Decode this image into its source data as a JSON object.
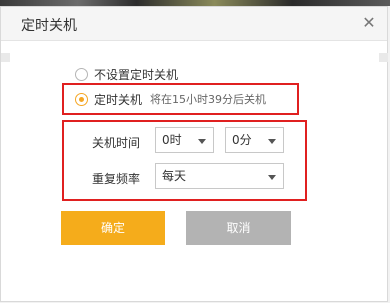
{
  "dialog": {
    "title": "定时关机",
    "close_icon": "close-icon"
  },
  "options": {
    "no_shutdown_label": "不设置定时关机",
    "timed_shutdown_label": "定时关机",
    "timed_shutdown_hint": "将在15小时39分后关机",
    "selected": "timed_shutdown"
  },
  "settings": {
    "time_label": "关机时间",
    "hour_value": "0时",
    "minute_value": "0分",
    "repeat_label": "重复频率",
    "repeat_value": "每天"
  },
  "buttons": {
    "ok_label": "确定",
    "cancel_label": "取消"
  },
  "colors": {
    "accent": "#f5ac1b",
    "highlight_box": "#e02020",
    "cancel_bg": "#b3b3b3"
  }
}
